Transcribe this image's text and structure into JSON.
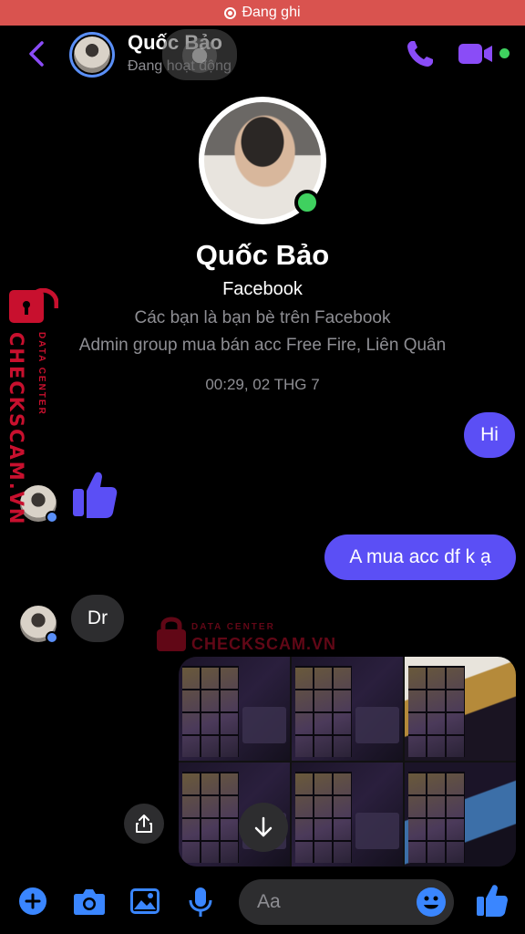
{
  "status_bar": {
    "recording_label": "Đang ghi"
  },
  "header": {
    "name": "Quốc Bảo",
    "status": "Đang hoạt động"
  },
  "profile": {
    "name": "Quốc Bảo",
    "platform": "Facebook",
    "info_line1": "Các bạn là bạn bè trên Facebook",
    "info_line2": "Admin group mua bán acc Free Fire, Liên Quân"
  },
  "conversation": {
    "timestamp": "00:29, 02 THG 7",
    "messages": [
      {
        "from": "me",
        "text": "Hi"
      },
      {
        "from": "them",
        "type": "like"
      },
      {
        "from": "me",
        "text": "A mua acc df k ạ"
      },
      {
        "from": "them",
        "text": "Dr"
      },
      {
        "from": "me",
        "type": "images",
        "count": 6
      }
    ]
  },
  "watermark": {
    "brand": "CHECKSCAM.VN",
    "tagline": "DATA CENTER"
  },
  "composer": {
    "placeholder": "Aa"
  },
  "colors": {
    "accent": "#5b4ff5",
    "icon_purple": "#8a4cf7",
    "icon_blue": "#3a86ff",
    "online": "#3fd15f",
    "incoming_bubble": "#2d2d2f",
    "recording_bar": "#d9534f",
    "watermark_red": "#c8102e"
  }
}
